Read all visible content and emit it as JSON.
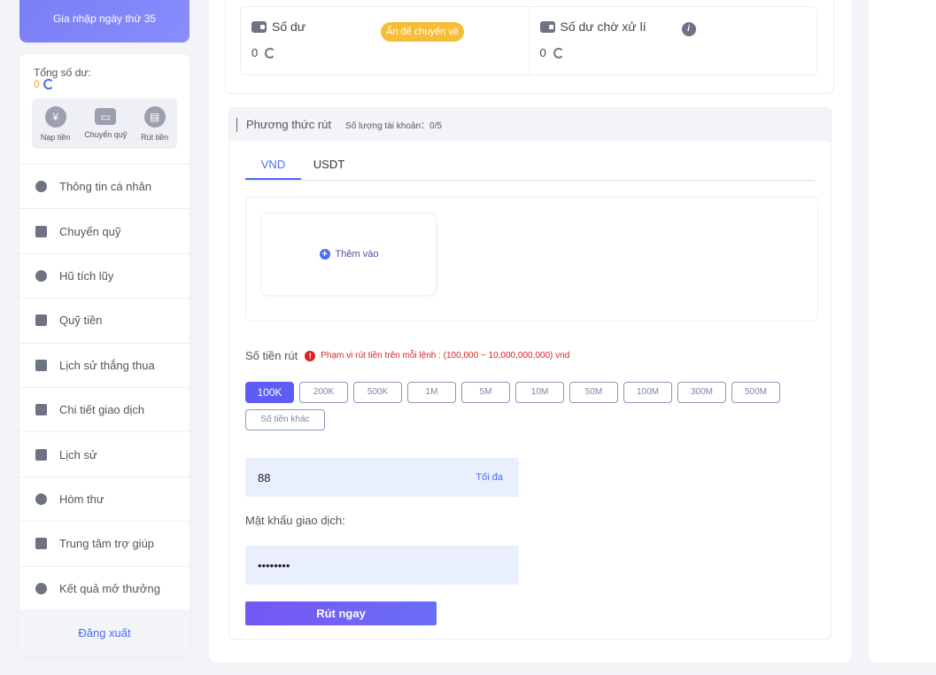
{
  "sidebar": {
    "join_text": "Gia nhập ngày thứ 35",
    "total_label": "Tổng số dư:",
    "total_value": "0",
    "quick_actions": [
      {
        "label": "Nạp tiền",
        "icon": "yen-icon"
      },
      {
        "label": "Chuyển quỹ",
        "icon": "wallet-icon"
      },
      {
        "label": "Rút tiền",
        "icon": "withdraw-icon"
      }
    ],
    "items": [
      {
        "label": "Thông tin cá nhân",
        "icon": "user-icon"
      },
      {
        "label": "Chuyển quỹ",
        "icon": "wallet-icon"
      },
      {
        "label": "Hũ tích lũy",
        "icon": "piggy-icon"
      },
      {
        "label": "Quỹ tiền",
        "icon": "fund-icon"
      },
      {
        "label": "Lịch sử thắng thua",
        "icon": "clipboard-icon"
      },
      {
        "label": "Chi tiết giao dịch",
        "icon": "chart-icon"
      },
      {
        "label": "Lịch sử",
        "icon": "coins-icon"
      },
      {
        "label": "Hòm thư",
        "icon": "mail-icon"
      },
      {
        "label": "Trung tâm trợ giúp",
        "icon": "book-icon"
      },
      {
        "label": "Kết quả mở thưởng",
        "icon": "trophy-icon"
      }
    ],
    "logout": "Đăng xuất"
  },
  "balance": {
    "main_label": "Số dư",
    "main_value": "0",
    "transfer_pill": "Ấn để chuyển về",
    "pending_label": "Số dư chờ xử lí",
    "pending_value": "0",
    "info_glyph": "i"
  },
  "withdraw": {
    "title": "Phương thức rút",
    "account_count": "Số lượng tài khoản：0/5",
    "tabs": [
      "VND",
      "USDT"
    ],
    "add_label": "Thêm vào",
    "add_glyph": "+",
    "amount_label": "Số tiền rút",
    "warn_glyph": "!",
    "amount_range": "Phạm vi rút tiền trên mỗi lệnh : (100,000 ~ 10,000,000,000) vnd",
    "chips": [
      "100K",
      "200K",
      "500K",
      "1M",
      "5M",
      "10M",
      "50M",
      "100M",
      "300M",
      "500M",
      "Số tiền khác"
    ],
    "selected_chip": "100K",
    "amount_value": "88",
    "max_label": "Tối đa",
    "password_label": "Mật khẩu giao dịch:",
    "password_value": "••••••••",
    "submit_label": "Rút ngay"
  },
  "colors": {
    "accent": "#4a6cf7",
    "primary_button": "#6f5cf6",
    "warning": "#e02020",
    "pill": "#f6bd38"
  }
}
